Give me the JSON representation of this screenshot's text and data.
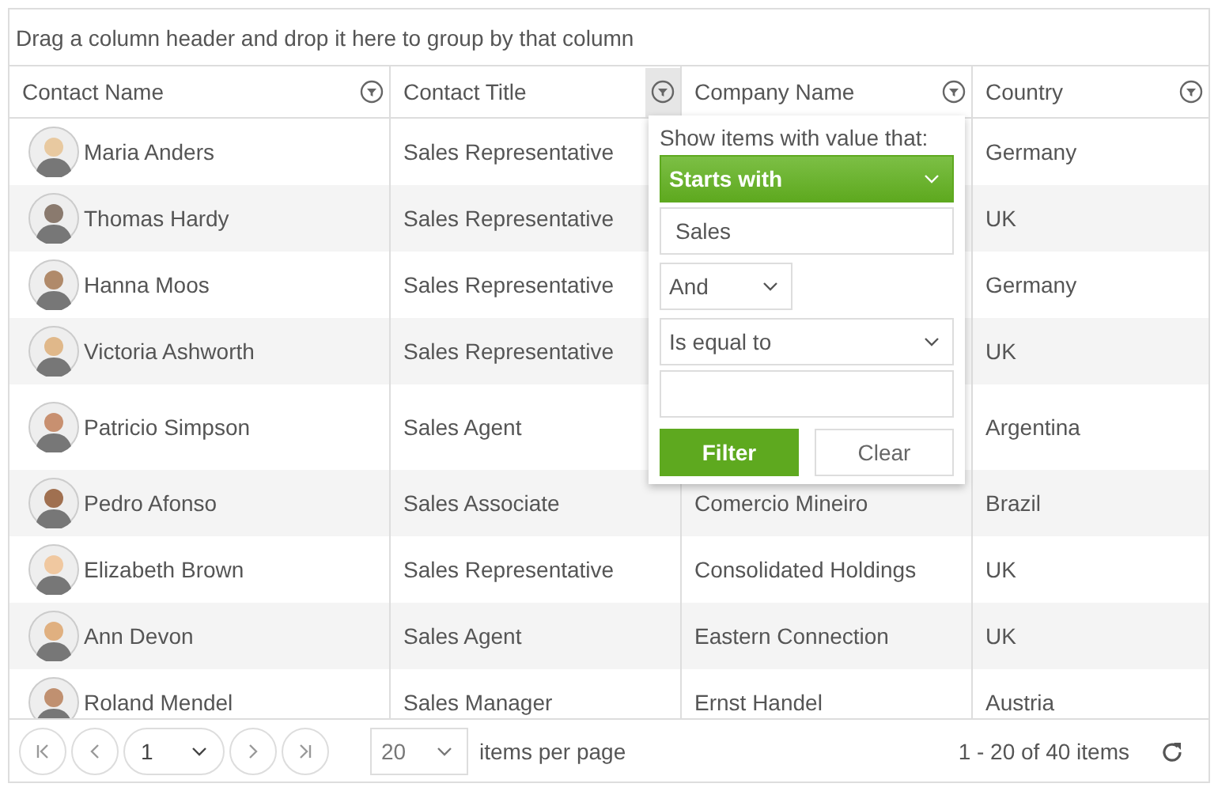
{
  "group_panel": {
    "hint": "Drag a column header and drop it here to group by that column"
  },
  "columns": [
    {
      "label": "Contact Name",
      "menu_open": false
    },
    {
      "label": "Contact Title",
      "menu_open": true
    },
    {
      "label": "Company Name",
      "menu_open": false
    },
    {
      "label": "Country",
      "menu_open": false
    }
  ],
  "rows": [
    {
      "contact_name": "Maria Anders",
      "contact_title": "Sales Representative",
      "country": "Germany"
    },
    {
      "contact_name": "Thomas Hardy",
      "contact_title": "Sales Representative",
      "country": "UK"
    },
    {
      "contact_name": "Hanna Moos",
      "contact_title": "Sales Representative",
      "country": "Germany"
    },
    {
      "contact_name": "Victoria Ashworth",
      "contact_title": "Sales Representative",
      "country": "UK"
    },
    {
      "contact_name": "Patricio Simpson",
      "contact_title": "Sales Agent",
      "country": "Argentina"
    },
    {
      "contact_name": "Pedro Afonso",
      "contact_title": "Sales Associate",
      "company_name": "Comercio Mineiro",
      "country": "Brazil"
    },
    {
      "contact_name": "Elizabeth Brown",
      "contact_title": "Sales Representative",
      "company_name": "Consolidated Holdings",
      "country": "UK"
    },
    {
      "contact_name": "Ann Devon",
      "contact_title": "Sales Agent",
      "company_name": "Eastern Connection",
      "country": "UK"
    },
    {
      "contact_name": "Roland Mendel",
      "contact_title": "Sales Manager",
      "company_name": "Ernst Handel",
      "country": "Austria"
    }
  ],
  "filter_menu": {
    "prompt": "Show items with value that:",
    "operator": "Starts with",
    "value": "Sales",
    "logic": "And",
    "operator_2": "Is equal to",
    "buttons": [
      "Filter",
      "Clear"
    ]
  },
  "pager": {
    "page": "1",
    "page_size": "20",
    "page_size_label": "items per page",
    "info": "1 - 20 of 40 items"
  }
}
